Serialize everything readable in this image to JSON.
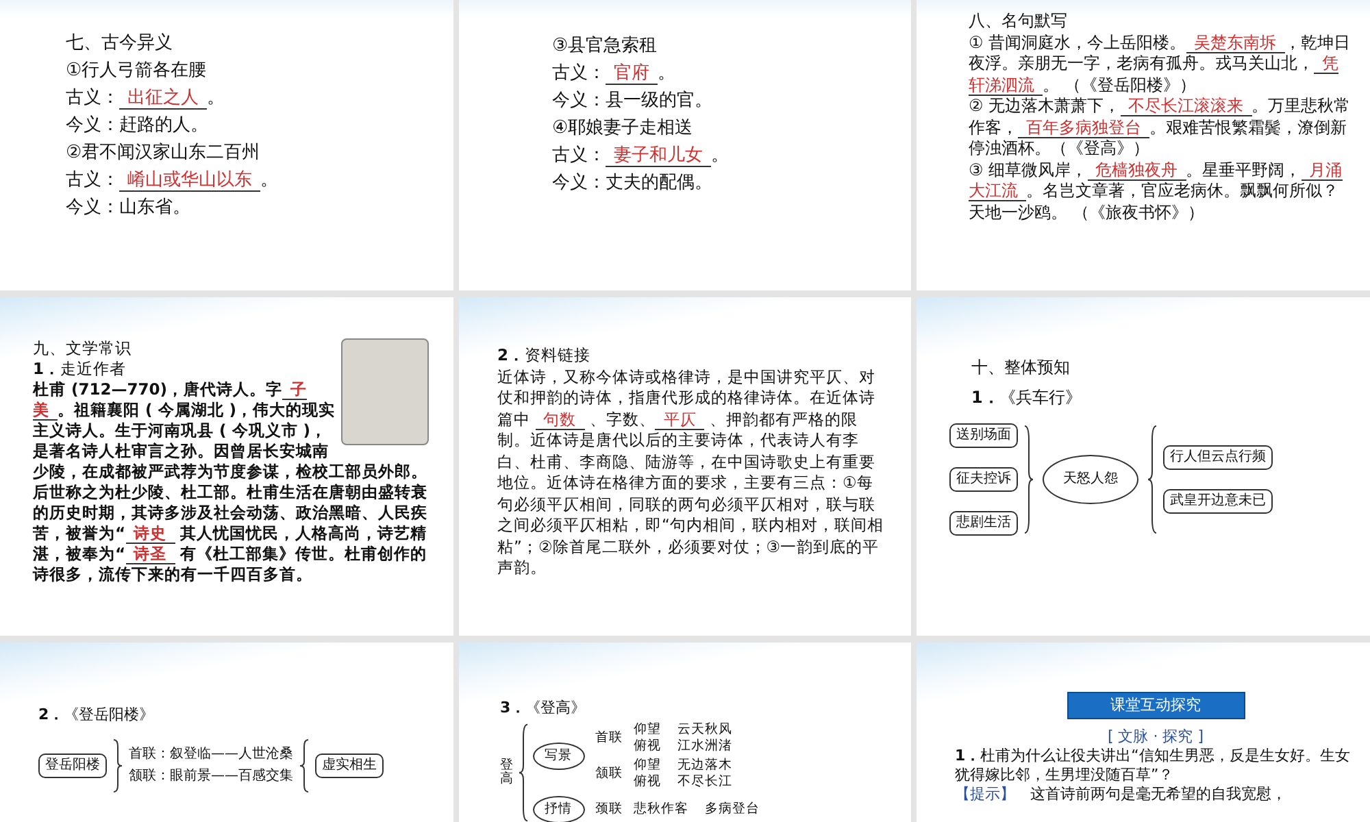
{
  "slides": [
    {
      "kind": "text",
      "lines": [
        {
          "kind": "plain",
          "parts": [
            {
              "kind": "plain",
              "t": "七、古今异义"
            }
          ]
        },
        {
          "kind": "plain",
          "parts": [
            {
              "kind": "plain",
              "t": "①行人弓箭各在腰"
            }
          ]
        },
        {
          "kind": "plain",
          "parts": [
            {
              "kind": "plain",
              "t": "古义："
            },
            {
              "kind": "answer",
              "t": "出征之人"
            },
            {
              "kind": "plain",
              "t": "。"
            }
          ]
        },
        {
          "kind": "plain",
          "parts": [
            {
              "kind": "plain",
              "t": "今义：赶路的人。"
            }
          ]
        },
        {
          "kind": "plain",
          "parts": [
            {
              "kind": "plain",
              "t": "②君不闻汉家山东二百州"
            }
          ]
        },
        {
          "kind": "plain",
          "parts": [
            {
              "kind": "plain",
              "t": "古义："
            },
            {
              "kind": "answer",
              "t": "崤山或华山以东"
            },
            {
              "kind": "plain",
              "t": "。"
            }
          ]
        },
        {
          "kind": "plain",
          "parts": [
            {
              "kind": "plain",
              "t": "今义：山东省。"
            }
          ]
        }
      ]
    },
    {
      "kind": "text",
      "lines": [
        {
          "kind": "plain",
          "parts": [
            {
              "kind": "plain",
              "t": "③县官急索租"
            }
          ]
        },
        {
          "kind": "plain",
          "parts": [
            {
              "kind": "plain",
              "t": "古义："
            },
            {
              "kind": "answer",
              "t": "官府"
            },
            {
              "kind": "plain",
              "t": "。"
            }
          ]
        },
        {
          "kind": "plain",
          "parts": [
            {
              "kind": "plain",
              "t": "今义：县一级的官。"
            }
          ]
        },
        {
          "kind": "plain",
          "parts": [
            {
              "kind": "plain",
              "t": "④耶娘妻子走相送"
            }
          ]
        },
        {
          "kind": "plain",
          "parts": [
            {
              "kind": "plain",
              "t": "古义："
            },
            {
              "kind": "answer",
              "t": "妻子和儿女"
            },
            {
              "kind": "plain",
              "t": "。"
            }
          ]
        },
        {
          "kind": "plain",
          "parts": [
            {
              "kind": "plain",
              "t": "今义：丈夫的配偶。"
            }
          ]
        }
      ]
    },
    {
      "kind": "text",
      "lines": [
        {
          "kind": "plain",
          "parts": [
            {
              "kind": "plain",
              "t": "八、名句默写"
            }
          ]
        },
        {
          "kind": "plain",
          "parts": [
            {
              "kind": "plain",
              "t": "① 昔闻洞庭水，今上岳阳楼。"
            },
            {
              "kind": "answer",
              "t": "吴楚东南坼"
            },
            {
              "kind": "plain",
              "t": "，乾坤日夜浮。亲朋无一字，老病有孤舟。戎马关山北，"
            },
            {
              "kind": "answer",
              "t": "凭轩涕泗流"
            },
            {
              "kind": "plain",
              "t": "。 （《登岳阳楼》）"
            }
          ]
        },
        {
          "kind": "plain",
          "parts": [
            {
              "kind": "plain",
              "t": "② 无边落木萧萧下，"
            },
            {
              "kind": "answer",
              "t": "不尽长江滚滚来"
            },
            {
              "kind": "plain",
              "t": "。万里悲秋常作客，"
            },
            {
              "kind": "answer",
              "t": "百年多病独登台"
            },
            {
              "kind": "plain",
              "t": "。艰难苦恨繁霜鬓，潦倒新停浊酒杯。（《登高》）"
            }
          ]
        },
        {
          "kind": "plain",
          "parts": [
            {
              "kind": "plain",
              "t": "③ 细草微风岸，"
            },
            {
              "kind": "answer",
              "t": "危樯独夜舟"
            },
            {
              "kind": "plain",
              "t": "。星垂平野阔，"
            },
            {
              "kind": "answer",
              "t": "月涌大江流"
            },
            {
              "kind": "plain",
              "t": "。名岂文章著，官应老病休。飘飘何所似？天地一沙鸥。 （《旅夜书怀》）"
            }
          ]
        }
      ]
    },
    {
      "kind": "text",
      "photo": true,
      "lines": [
        {
          "kind": "plain",
          "parts": [
            {
              "kind": "plain",
              "t": "九、文学常识"
            }
          ]
        },
        {
          "kind": "plain",
          "parts": [
            {
              "kind": "bold",
              "t": "1．"
            },
            {
              "kind": "plain",
              "t": "走近作者"
            }
          ]
        },
        {
          "kind": "plain",
          "parts": [
            {
              "kind": "bold",
              "t": "杜甫 (712—770)，唐代诗人。字"
            },
            {
              "kind": "answer",
              "t": "子美"
            },
            {
              "kind": "bold",
              "t": "。祖籍襄阳 ( 今属湖北 )，伟大的现实主义诗人。生于河南巩县 ( 今巩义市 )，是著名诗人杜审言之孙。因曾居长安城南少陵，在成都被严武荐为节度参谋，检校工部员外郎。后世称之为杜少陵、杜工部。杜甫生活在唐朝由盛转衰的历史时期，其诗多涉及社会动荡、政治黑暗、人民疾苦，被誉为“"
            },
            {
              "kind": "answer",
              "t": "诗史"
            },
            {
              "kind": "bold",
              "t": " 其人忧国忧民，人格高尚，诗艺精湛，被奉为“"
            },
            {
              "kind": "answer",
              "t": "诗圣"
            },
            {
              "kind": "bold",
              "t": " 有《杜工部集》传世。杜甫创作的诗很多，流传下来的有一千四百多首。"
            }
          ]
        }
      ]
    },
    {
      "kind": "text",
      "lines": [
        {
          "kind": "plain",
          "parts": [
            {
              "kind": "bold",
              "t": "2．"
            },
            {
              "kind": "plain",
              "t": "资料链接"
            }
          ]
        },
        {
          "kind": "plain",
          "parts": [
            {
              "kind": "plain",
              "t": "近体诗，又称今体诗或格律诗，是中国讲究平仄、对仗和押韵的诗体，指唐代形成的格律诗体。在近体诗篇中 "
            },
            {
              "kind": "answer",
              "t": "句数"
            },
            {
              "kind": "plain",
              "t": " 、字数、"
            },
            {
              "kind": "answer",
              "t": "平仄"
            },
            {
              "kind": "plain",
              "t": " 、押韵都有严格的限制。近体诗是唐代以后的主要诗体，代表诗人有李白、杜甫、李商隐、陆游等，在中国诗歌史上有重要地位。近体诗在格律方面的要求，主要有三点：①每句必须平仄相间，同联的两句必须平仄相对，联与联之间必须平仄相粘，即“句内相间，联内相对，联间相粘”；②除首尾二联外，必须要对仗；③一韵到底的平声韵。"
            }
          ]
        }
      ]
    },
    {
      "kind": "mindmap",
      "lines": [
        {
          "kind": "plain",
          "parts": [
            {
              "kind": "plain",
              "t": "十、整体预知"
            }
          ]
        },
        {
          "kind": "plain",
          "parts": [
            {
              "kind": "bold",
              "t": "1．"
            },
            {
              "kind": "plain",
              "t": "《兵车行》"
            }
          ]
        }
      ],
      "map": {
        "left": [
          "送别场面",
          "征夫控诉",
          "悲剧生活"
        ],
        "center": {
          "kind": "ellipse",
          "items": [
            "天怒人怨"
          ]
        },
        "right": [
          "行人但云点行频",
          "武皇开边意未已"
        ]
      }
    },
    {
      "kind": "mindmap",
      "lines": [
        {
          "kind": "plain",
          "parts": [
            {
              "kind": "bold",
              "t": "2．"
            },
            {
              "kind": "plain",
              "t": "《登岳阳楼》"
            }
          ]
        }
      ],
      "map": {
        "left": [
          "登岳阳楼"
        ],
        "center": {
          "kind": "plain",
          "items": [
            "首联：叙登临——人世沧桑",
            "颔联：眼前景——百感交集"
          ]
        },
        "right": [
          "虚实相生"
        ]
      }
    },
    {
      "kind": "tree",
      "lines": [
        {
          "kind": "plain",
          "parts": [
            {
              "kind": "bold",
              "t": "3．"
            },
            {
              "kind": "plain",
              "t": "《登高》"
            }
          ]
        }
      ],
      "tree": {
        "root": "登高",
        "groups": [
          {
            "label": "写景",
            "rows": [
              {
                "label": "首联",
                "items": [
                  [
                    "仰望",
                    "云天秋风"
                  ],
                  [
                    "俯视",
                    "江水洲渚"
                  ]
                ]
              },
              {
                "label": "颔联",
                "items": [
                  [
                    "仰望",
                    "无边落木"
                  ],
                  [
                    "俯视",
                    "不尽长江"
                  ]
                ]
              }
            ]
          },
          {
            "label": "抒情",
            "rows": [
              {
                "label": "颈联",
                "items": [
                  [
                    "悲秋作客",
                    "多病登台"
                  ]
                ]
              }
            ]
          }
        ]
      }
    },
    {
      "kind": "text",
      "banner": "课堂互动探究",
      "lines": [
        {
          "kind": "centered",
          "parts": [
            {
              "kind": "note",
              "t": "[ 文脉 · 探究 ]"
            }
          ]
        },
        {
          "kind": "plain",
          "parts": [
            {
              "kind": "bold",
              "t": "1．"
            },
            {
              "kind": "plain",
              "t": "杜甫为什么让役夫讲出“信知生男恶，反是生女好。生女犹得嫁比邻，生男埋没随百草”？"
            }
          ]
        },
        {
          "kind": "plain",
          "parts": [
            {
              "kind": "note",
              "t": "【提示】"
            },
            {
              "kind": "plain",
              "t": "　这首诗前两句是毫无希望的自我宽慰，"
            }
          ]
        }
      ]
    }
  ]
}
